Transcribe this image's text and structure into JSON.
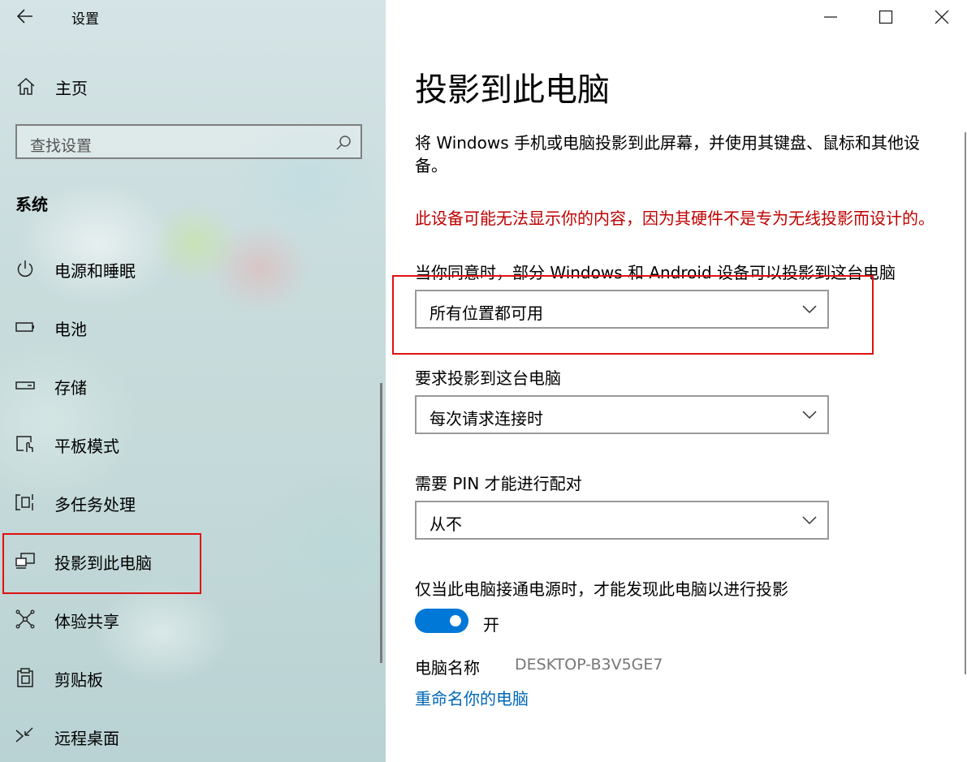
{
  "app": {
    "title": "设置"
  },
  "sidebar": {
    "home_label": "主页",
    "search_placeholder": "查找设置",
    "section_title": "系统",
    "items": [
      {
        "label": "电源和睡眠",
        "icon": "power-icon"
      },
      {
        "label": "电池",
        "icon": "battery-icon"
      },
      {
        "label": "存储",
        "icon": "storage-icon"
      },
      {
        "label": "平板模式",
        "icon": "tablet-mode-icon"
      },
      {
        "label": "多任务处理",
        "icon": "multitasking-icon"
      },
      {
        "label": "投影到此电脑",
        "icon": "project-to-pc-icon",
        "selected": true
      },
      {
        "label": "体验共享",
        "icon": "shared-experiences-icon"
      },
      {
        "label": "剪贴板",
        "icon": "clipboard-icon"
      },
      {
        "label": "远程桌面",
        "icon": "remote-desktop-icon"
      }
    ]
  },
  "main": {
    "title": "投影到此电脑",
    "description": "将 Windows 手机或电脑投影到此屏幕，并使用其键盘、鼠标和其他设备。",
    "warning": "此设备可能无法显示你的内容，因为其硬件不是专为无线投影而设计的。",
    "availability": {
      "label": "当你同意时，部分 Windows 和 Android 设备可以投影到这台电脑",
      "value": "所有位置都可用"
    },
    "ask_to_project": {
      "label": "要求投影到这台电脑",
      "value": "每次请求连接时"
    },
    "require_pin": {
      "label": "需要 PIN 才能进行配对",
      "value": "从不"
    },
    "power_only": {
      "label": "仅当此电脑接通电源时，才能发现此电脑以进行投影",
      "toggle_state": "开",
      "toggle_on": true
    },
    "pc_name": {
      "label": "电脑名称",
      "value": "DESKTOP-B3V5GE7"
    },
    "rename_link": "重命名你的电脑"
  },
  "colors": {
    "accent": "#0078d7",
    "link": "#0067b8",
    "warning": "#c00000",
    "highlight_box": "#e01010"
  }
}
